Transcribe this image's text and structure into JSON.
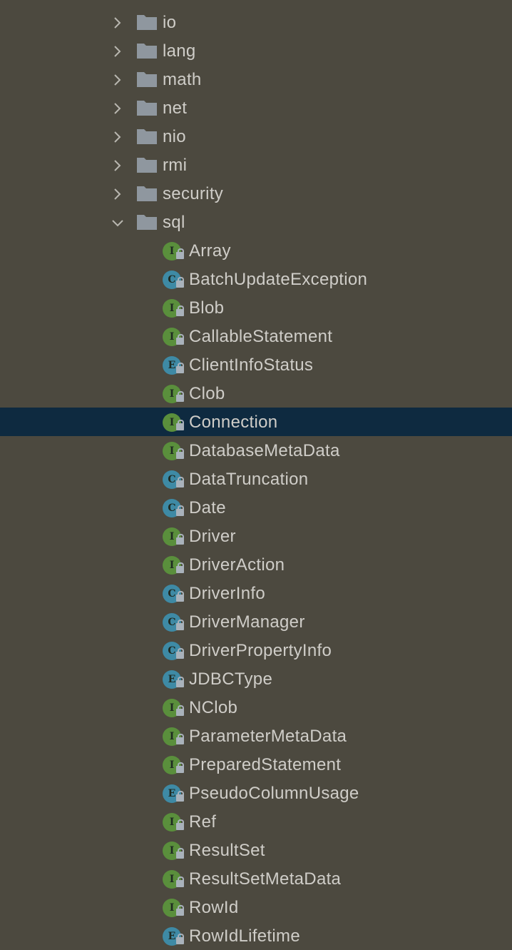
{
  "colors": {
    "background": "#4c493f",
    "selection": "#0e2a40",
    "interface": "#5a8f3c",
    "class": "#3e8aa5",
    "enum": "#3e8aa5",
    "folder": "#8f979f",
    "text": "#cfcdc8"
  },
  "packages": [
    {
      "label": "io",
      "expanded": false
    },
    {
      "label": "lang",
      "expanded": false
    },
    {
      "label": "math",
      "expanded": false
    },
    {
      "label": "net",
      "expanded": false
    },
    {
      "label": "nio",
      "expanded": false
    },
    {
      "label": "rmi",
      "expanded": false
    },
    {
      "label": "security",
      "expanded": false
    },
    {
      "label": "sql",
      "expanded": true
    }
  ],
  "sql_children": [
    {
      "label": "Array",
      "kind": "I"
    },
    {
      "label": "BatchUpdateException",
      "kind": "C"
    },
    {
      "label": "Blob",
      "kind": "I"
    },
    {
      "label": "CallableStatement",
      "kind": "I"
    },
    {
      "label": "ClientInfoStatus",
      "kind": "E"
    },
    {
      "label": "Clob",
      "kind": "I"
    },
    {
      "label": "Connection",
      "kind": "I",
      "selected": true
    },
    {
      "label": "DatabaseMetaData",
      "kind": "I"
    },
    {
      "label": "DataTruncation",
      "kind": "C"
    },
    {
      "label": "Date",
      "kind": "C"
    },
    {
      "label": "Driver",
      "kind": "I"
    },
    {
      "label": "DriverAction",
      "kind": "I"
    },
    {
      "label": "DriverInfo",
      "kind": "C"
    },
    {
      "label": "DriverManager",
      "kind": "C"
    },
    {
      "label": "DriverPropertyInfo",
      "kind": "C"
    },
    {
      "label": "JDBCType",
      "kind": "E"
    },
    {
      "label": "NClob",
      "kind": "I"
    },
    {
      "label": "ParameterMetaData",
      "kind": "I"
    },
    {
      "label": "PreparedStatement",
      "kind": "I"
    },
    {
      "label": "PseudoColumnUsage",
      "kind": "E"
    },
    {
      "label": "Ref",
      "kind": "I"
    },
    {
      "label": "ResultSet",
      "kind": "I"
    },
    {
      "label": "ResultSetMetaData",
      "kind": "I"
    },
    {
      "label": "RowId",
      "kind": "I"
    },
    {
      "label": "RowIdLifetime",
      "kind": "E"
    }
  ]
}
